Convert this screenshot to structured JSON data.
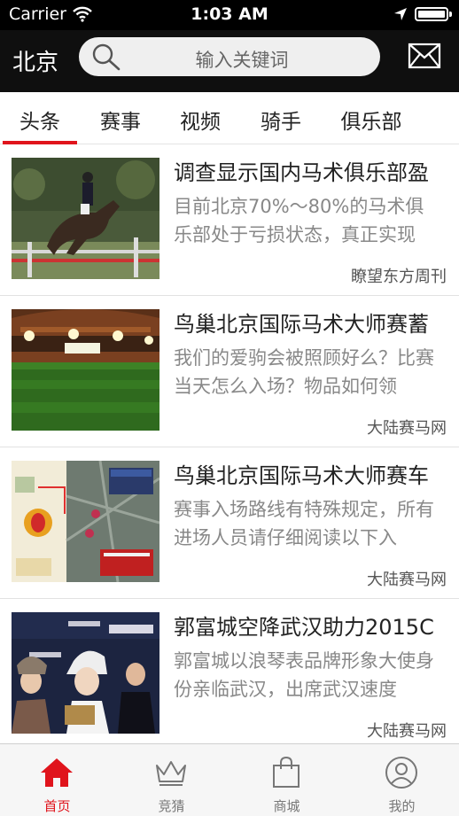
{
  "status_bar": {
    "carrier": "Carrier",
    "time": "1:03 AM"
  },
  "header": {
    "city": "北京",
    "search_placeholder": "输入关键词"
  },
  "tabs": [
    {
      "label": "头条",
      "active": true
    },
    {
      "label": "赛事"
    },
    {
      "label": "视频"
    },
    {
      "label": "骑手"
    },
    {
      "label": "俱乐部"
    }
  ],
  "news": [
    {
      "title": "调查显示国内马术俱乐部盈",
      "summary": "目前北京70%～80%的马术俱乐部处于亏损状态，真正实现",
      "source": "瞭望东方周刊"
    },
    {
      "title": "鸟巢北京国际马术大师赛蓄",
      "summary": "我们的爱驹会被照顾好么？比赛当天怎么入场？物品如何领",
      "source": "大陆赛马网"
    },
    {
      "title": "鸟巢北京国际马术大师赛车",
      "summary": "赛事入场路线有特殊规定，所有进场人员请仔细阅读以下入",
      "source": "大陆赛马网"
    },
    {
      "title": "郭富城空降武汉助力2015C",
      "summary": "郭富城以浪琴表品牌形象大使身份亲临武汉，出席武汉速度",
      "source": "大陆赛马网"
    }
  ],
  "tab_bar": [
    {
      "label": "首页",
      "icon": "home-icon",
      "active": true
    },
    {
      "label": "竞猜",
      "icon": "crown-icon"
    },
    {
      "label": "商城",
      "icon": "shopping-bag-icon"
    },
    {
      "label": "我的",
      "icon": "user-icon"
    }
  ],
  "colors": {
    "accent": "#e0141c",
    "header_bg": "#0f0f0f"
  }
}
